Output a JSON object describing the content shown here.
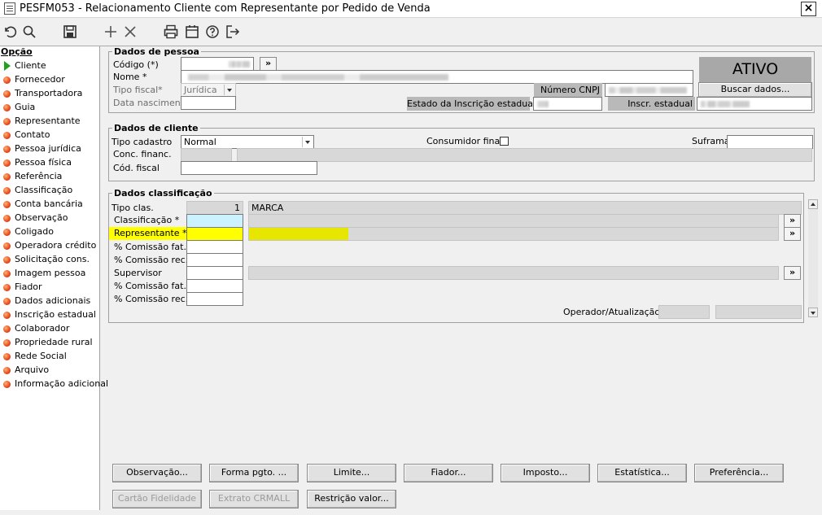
{
  "window": {
    "title": "PESFM053 - Relacionamento Cliente com Representante por Pedido de Venda",
    "close_label": "×"
  },
  "sidebar": {
    "heading": "Opção",
    "items": [
      {
        "label": "Cliente",
        "active": true
      },
      {
        "label": "Fornecedor"
      },
      {
        "label": "Transportadora"
      },
      {
        "label": "Guia"
      },
      {
        "label": "Representante"
      },
      {
        "label": "Contato"
      },
      {
        "label": "Pessoa jurídica"
      },
      {
        "label": "Pessoa física"
      },
      {
        "label": "Referência"
      },
      {
        "label": "Classificação"
      },
      {
        "label": "Conta bancária"
      },
      {
        "label": "Observação"
      },
      {
        "label": "Coligado"
      },
      {
        "label": "Operadora crédito"
      },
      {
        "label": "Solicitação cons."
      },
      {
        "label": "Imagem pessoa"
      },
      {
        "label": "Fiador"
      },
      {
        "label": "Dados adicionais"
      },
      {
        "label": "Inscrição estadual"
      },
      {
        "label": "Colaborador"
      },
      {
        "label": "Propriedade rural"
      },
      {
        "label": "Rede Social"
      },
      {
        "label": "Arquivo"
      },
      {
        "label": "Informação adicional"
      }
    ]
  },
  "pessoa": {
    "legend": "Dados de pessoa",
    "codigo_label": "Código (*)",
    "nome_label": "Nome *",
    "tipo_fiscal_label": "Tipo fiscal*",
    "tipo_fiscal_value": "Jurídica",
    "data_nasc_label": "Data nascimento",
    "status": "ATIVO",
    "cnpj_label": "Número CNPJ",
    "buscar_label": "Buscar dados...",
    "estado_ie_label": "Estado da Inscrição estadual",
    "inscr_estadual_label": "Inscr. estadual",
    "lookup": "»"
  },
  "cliente": {
    "legend": "Dados de cliente",
    "tipo_cadastro_label": "Tipo cadastro",
    "tipo_cadastro_value": "Normal",
    "consumidor_final_label": "Consumidor final",
    "suframa_label": "Suframa",
    "conc_financ_label": "Conc. financ.",
    "cod_fiscal_label": "Cód. fiscal"
  },
  "classificacao": {
    "legend": "Dados classificação",
    "tipo_clas_label": "Tipo clas.",
    "tipo_clas_value": "1",
    "tipo_clas_desc": "MARCA",
    "classificacao_label": "Classificação *",
    "representante_label": "Representante *",
    "comissao_fat_label": "% Comissão fat.",
    "comissao_rec_label": "% Comissão rec.",
    "supervisor_label": "Supervisor",
    "comissao_fat2_label": "% Comissão fat.",
    "comissao_rec2_label": "% Comissão rec.",
    "operador_label": "Operador/Atualização",
    "lookup": "»"
  },
  "buttons": {
    "observacao": "Observação...",
    "forma_pgto": "Forma pgto. ...",
    "limite": "Limite...",
    "fiador": "Fiador...",
    "imposto": "Imposto...",
    "estatistica": "Estatística...",
    "preferencia": "Preferência...",
    "cartao": "Cartão Fidelidade",
    "extrato": "Extrato CRMALL",
    "restricao": "Restrição valor..."
  },
  "colors": {
    "highlight": "#ffff00",
    "focus_field": "#ccf2ff",
    "status_bg": "#a8a8a8",
    "bullet": "#e03a10",
    "active_arrow": "#20a020"
  },
  "toolbar_icons": [
    "undo-icon",
    "search-icon",
    "save-icon",
    "add-icon",
    "delete-icon",
    "print-icon",
    "calendar-icon",
    "help-icon",
    "exit-icon"
  ]
}
